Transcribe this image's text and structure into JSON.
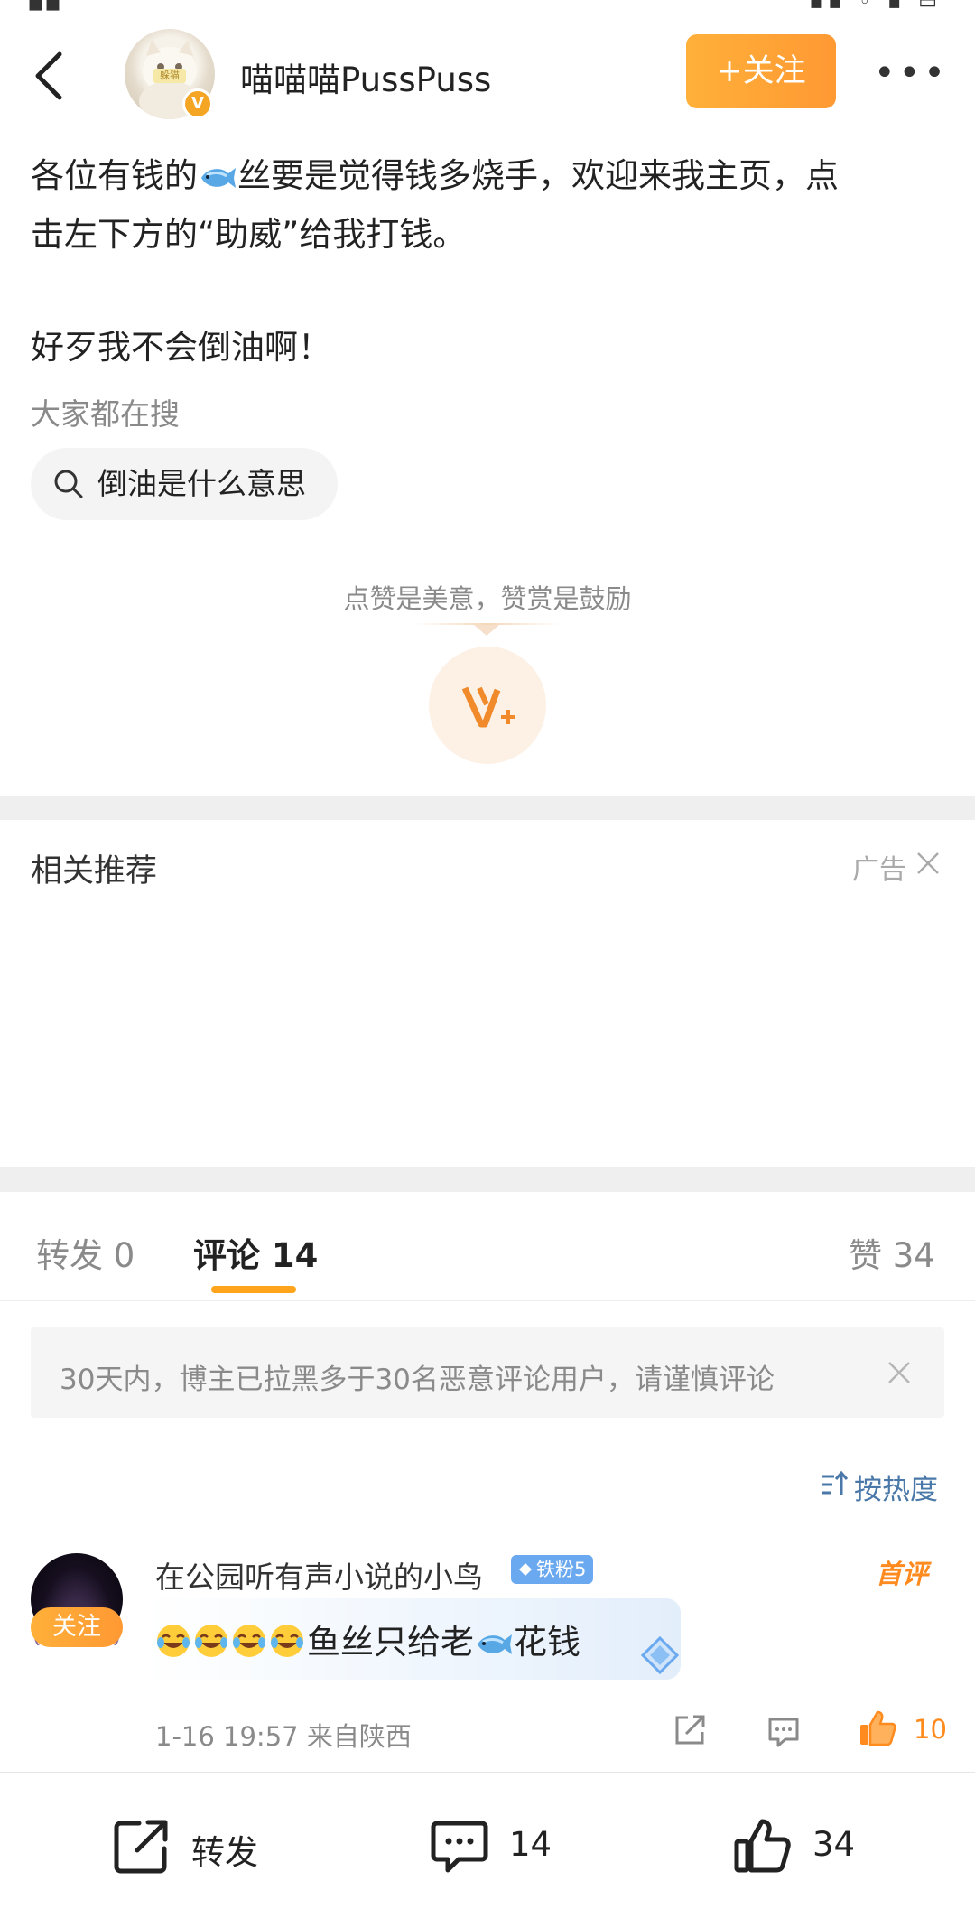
{
  "header": {
    "username": "喵喵喵PussPuss",
    "follow_label": "+关注",
    "more_label": "•••",
    "avatar_tag": "躲猫"
  },
  "post": {
    "line1_a": "各位有钱的",
    "line1_b": "丝要是觉得钱多烧手，欢迎来我主页，点",
    "line2": "击左下方的“助威”给我打钱。",
    "line3": "好歹我不会倒油啊！"
  },
  "search": {
    "label": "大家都在搜",
    "chip": "倒油是什么意思"
  },
  "reward": {
    "text": "点赞是美意，赞赏是鼓励"
  },
  "related": {
    "title": "相关推荐",
    "ad_label": "广告"
  },
  "tabs": {
    "repost": "转发 0",
    "comment": "评论 14",
    "like": "赞 34"
  },
  "notice": {
    "text": "30天内，博主已拉黑多于30名恶意评论用户，请谨慎评论"
  },
  "sort": {
    "label": "按热度"
  },
  "comment": {
    "follow_label": "关注",
    "name": "在公园听有声小说的小鸟",
    "fan_badge": "铁粉5",
    "first_badge": "首评",
    "text_a": "鱼丝只给老",
    "text_b": "花钱",
    "meta": "1-16 19:57 来自陕西",
    "like_count": "10"
  },
  "bottombar": {
    "repost": "转发",
    "comment_count": "14",
    "like_count": "34"
  },
  "colors": {
    "accent_orange": "#ff9933",
    "link_blue": "#4a78a8",
    "fan_badge_blue": "#6aa8ef"
  },
  "icons": [
    "back-arrow-icon",
    "verified-v-icon",
    "fish-emoji-icon",
    "search-icon",
    "reward-v-icon",
    "close-icon",
    "sort-icon",
    "diamond-icon",
    "laugh-cry-emoji-icon",
    "share-icon",
    "reply-icon",
    "thumb-up-icon",
    "comment-bubble-icon"
  ]
}
